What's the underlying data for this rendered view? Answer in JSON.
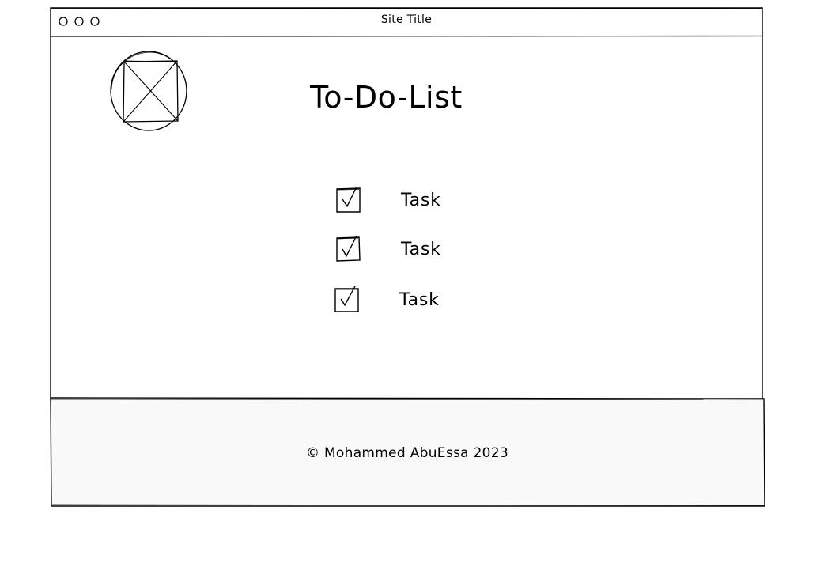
{
  "window": {
    "title": "Site Title",
    "controls": [
      "circle-icon",
      "circle-icon",
      "circle-icon"
    ]
  },
  "header": {
    "logo_icon": "image-placeholder-icon",
    "title": "To-Do-List"
  },
  "tasks": [
    {
      "label": "Task",
      "checked": true
    },
    {
      "label": "Task",
      "checked": true
    },
    {
      "label": "Task",
      "checked": true
    }
  ],
  "footer": {
    "text": "© Mohammed AbuEssa 2023"
  },
  "colors": {
    "stroke": "#000000",
    "background": "#ffffff",
    "footer_background": "#f9f9f9"
  }
}
